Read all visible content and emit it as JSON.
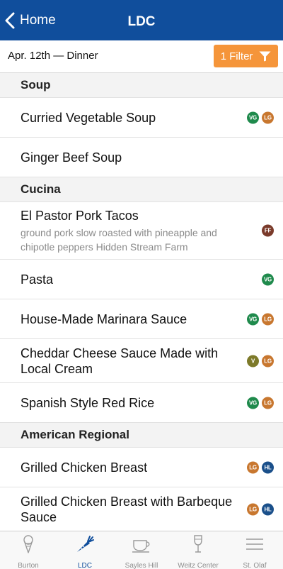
{
  "nav": {
    "back_label": "Home",
    "title": "LDC"
  },
  "filter": {
    "date_label": "Apr. 12th — Dinner",
    "button_label": "1 Filter"
  },
  "colors": {
    "nav_blue": "#104e9c",
    "accent_orange": "#f5953a",
    "vg": "#1f8a4c",
    "lg": "#c8772f",
    "ff": "#7a3a2a",
    "v": "#7d7a2a",
    "hl": "#1a4f8a"
  },
  "sections": [
    {
      "title": "Soup",
      "items": [
        {
          "title": "Curried Vegetable Soup",
          "badges": [
            "VG",
            "LG"
          ]
        },
        {
          "title": "Ginger Beef Soup",
          "badges": []
        }
      ]
    },
    {
      "title": "Cucina",
      "items": [
        {
          "title": "El Pastor Pork Tacos",
          "desc": "ground pork slow roasted with pineapple and chipotle peppers Hidden Stream Farm",
          "badges": [
            "FF"
          ]
        },
        {
          "title": "Pasta",
          "badges": [
            "VG"
          ]
        },
        {
          "title": "House-Made Marinara Sauce",
          "badges": [
            "VG",
            "LG"
          ]
        },
        {
          "title": "Cheddar Cheese Sauce Made with Local Cream",
          "badges": [
            "V",
            "LG"
          ]
        },
        {
          "title": "Spanish Style Red Rice",
          "badges": [
            "VG",
            "LG"
          ]
        }
      ]
    },
    {
      "title": "American Regional",
      "items": [
        {
          "title": "Grilled Chicken Breast",
          "badges": [
            "LG",
            "HL"
          ]
        },
        {
          "title": "Grilled Chicken Breast with Barbeque Sauce",
          "badges": [
            "LG",
            "HL"
          ]
        }
      ]
    }
  ],
  "tabs": [
    {
      "label": "Burton",
      "icon": "ice-cream-icon",
      "active": false
    },
    {
      "label": "LDC",
      "icon": "carrot-icon",
      "active": true
    },
    {
      "label": "Sayles Hill",
      "icon": "coffee-cup-icon",
      "active": false
    },
    {
      "label": "Weitz Center",
      "icon": "wine-glass-icon",
      "active": false
    },
    {
      "label": "St. Olaf",
      "icon": "menu-lines-icon",
      "active": false
    }
  ]
}
